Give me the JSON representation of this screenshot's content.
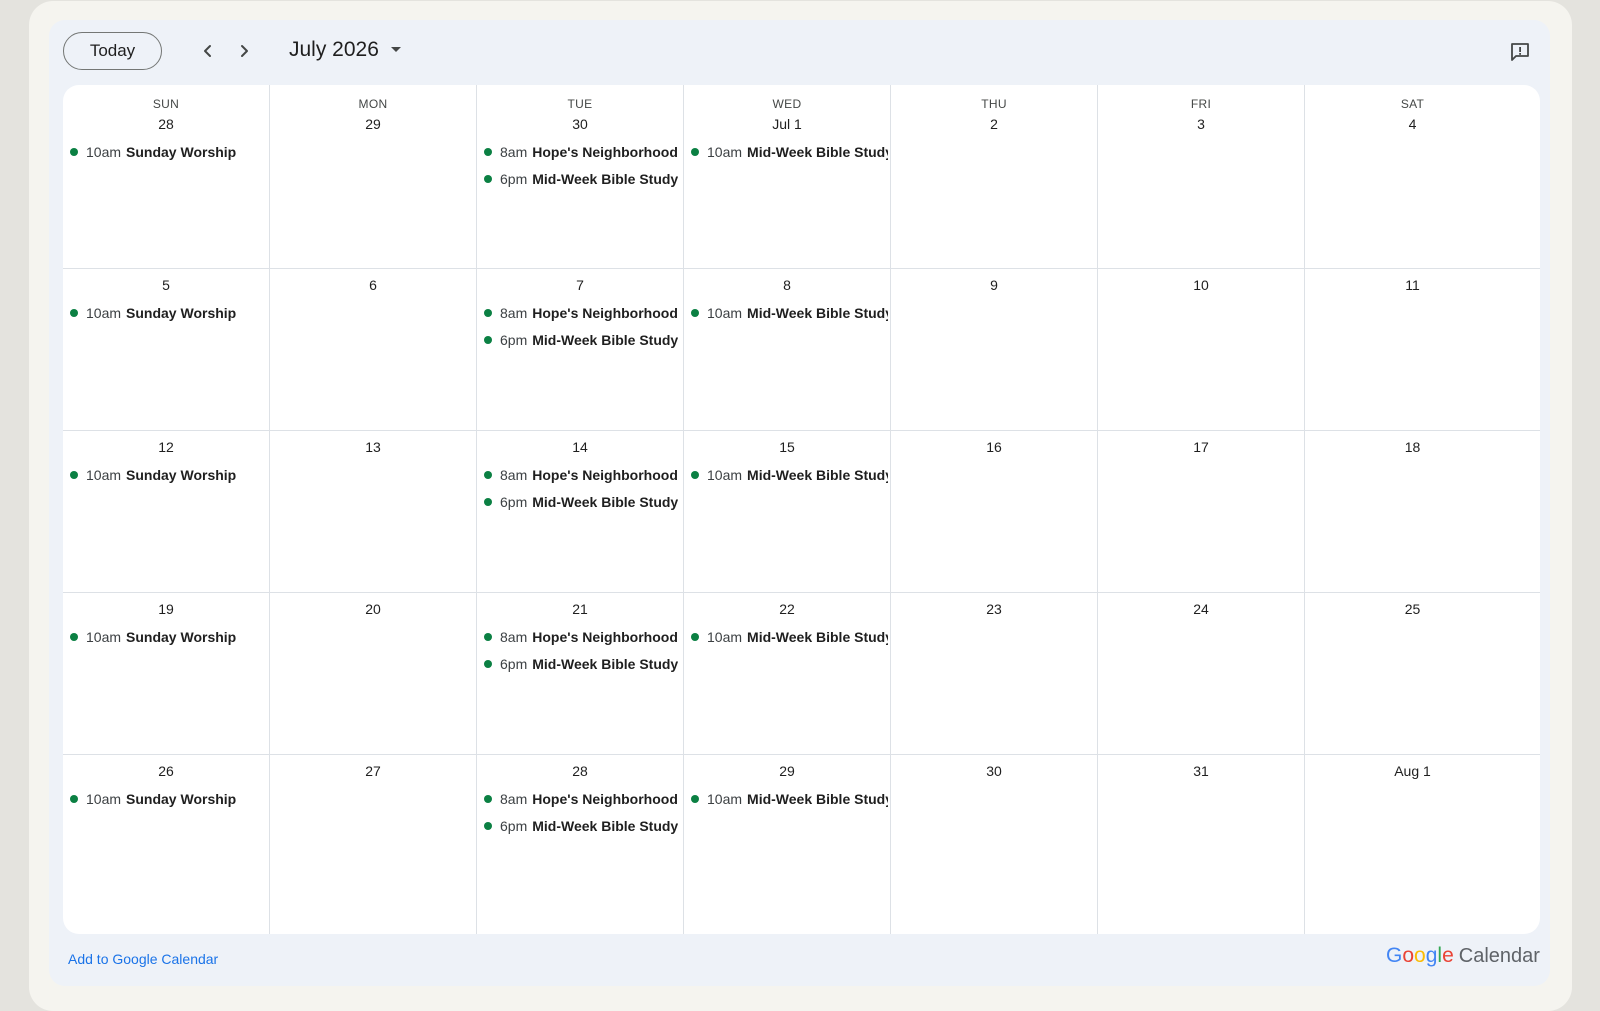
{
  "header": {
    "today_label": "Today",
    "month_label": "July 2026"
  },
  "days_of_week": [
    "SUN",
    "MON",
    "TUE",
    "WED",
    "THU",
    "FRI",
    "SAT"
  ],
  "weeks": [
    {
      "days": [
        {
          "label": "28",
          "events": [
            {
              "time": "10am",
              "title": "Sunday Worship"
            }
          ]
        },
        {
          "label": "29",
          "events": []
        },
        {
          "label": "30",
          "events": [
            {
              "time": "8am",
              "title": "Hope's Neighborhood Outreach"
            },
            {
              "time": "6pm",
              "title": "Mid-Week Bible Study"
            }
          ]
        },
        {
          "label": "Jul 1",
          "events": [
            {
              "time": "10am",
              "title": "Mid-Week Bible Study"
            }
          ]
        },
        {
          "label": "2",
          "events": []
        },
        {
          "label": "3",
          "events": []
        },
        {
          "label": "4",
          "events": []
        }
      ]
    },
    {
      "days": [
        {
          "label": "5",
          "events": [
            {
              "time": "10am",
              "title": "Sunday Worship"
            }
          ]
        },
        {
          "label": "6",
          "events": []
        },
        {
          "label": "7",
          "events": [
            {
              "time": "8am",
              "title": "Hope's Neighborhood Outreach"
            },
            {
              "time": "6pm",
              "title": "Mid-Week Bible Study"
            }
          ]
        },
        {
          "label": "8",
          "events": [
            {
              "time": "10am",
              "title": "Mid-Week Bible Study"
            }
          ]
        },
        {
          "label": "9",
          "events": []
        },
        {
          "label": "10",
          "events": []
        },
        {
          "label": "11",
          "events": []
        }
      ]
    },
    {
      "days": [
        {
          "label": "12",
          "events": [
            {
              "time": "10am",
              "title": "Sunday Worship"
            }
          ]
        },
        {
          "label": "13",
          "events": []
        },
        {
          "label": "14",
          "events": [
            {
              "time": "8am",
              "title": "Hope's Neighborhood Outreach"
            },
            {
              "time": "6pm",
              "title": "Mid-Week Bible Study"
            }
          ]
        },
        {
          "label": "15",
          "events": [
            {
              "time": "10am",
              "title": "Mid-Week Bible Study"
            }
          ]
        },
        {
          "label": "16",
          "events": []
        },
        {
          "label": "17",
          "events": []
        },
        {
          "label": "18",
          "events": []
        }
      ]
    },
    {
      "days": [
        {
          "label": "19",
          "events": [
            {
              "time": "10am",
              "title": "Sunday Worship"
            }
          ]
        },
        {
          "label": "20",
          "events": []
        },
        {
          "label": "21",
          "events": [
            {
              "time": "8am",
              "title": "Hope's Neighborhood Outreach"
            },
            {
              "time": "6pm",
              "title": "Mid-Week Bible Study"
            }
          ]
        },
        {
          "label": "22",
          "events": [
            {
              "time": "10am",
              "title": "Mid-Week Bible Study"
            }
          ]
        },
        {
          "label": "23",
          "events": []
        },
        {
          "label": "24",
          "events": []
        },
        {
          "label": "25",
          "events": []
        }
      ]
    },
    {
      "days": [
        {
          "label": "26",
          "events": [
            {
              "time": "10am",
              "title": "Sunday Worship"
            }
          ]
        },
        {
          "label": "27",
          "events": []
        },
        {
          "label": "28",
          "events": [
            {
              "time": "8am",
              "title": "Hope's Neighborhood Outreach"
            },
            {
              "time": "6pm",
              "title": "Mid-Week Bible Study"
            }
          ]
        },
        {
          "label": "29",
          "events": [
            {
              "time": "10am",
              "title": "Mid-Week Bible Study"
            }
          ]
        },
        {
          "label": "30",
          "events": []
        },
        {
          "label": "31",
          "events": []
        },
        {
          "label": "Aug 1",
          "events": []
        }
      ]
    }
  ],
  "footer": {
    "add_link": "Add to Google Calendar",
    "brand_letters": [
      "G",
      "o",
      "o",
      "g",
      "l",
      "e"
    ],
    "brand_product": "Calendar"
  },
  "colors": {
    "event_dot": "#0b8043",
    "link": "#1a73e8",
    "google_blue": "#4285f4",
    "google_red": "#ea4335",
    "google_yellow": "#fbbc05",
    "google_green": "#34a853"
  },
  "icons": {
    "prev": "chevron-left-icon",
    "next": "chevron-right-icon",
    "dropdown": "caret-down-icon",
    "feedback": "feedback-icon"
  }
}
